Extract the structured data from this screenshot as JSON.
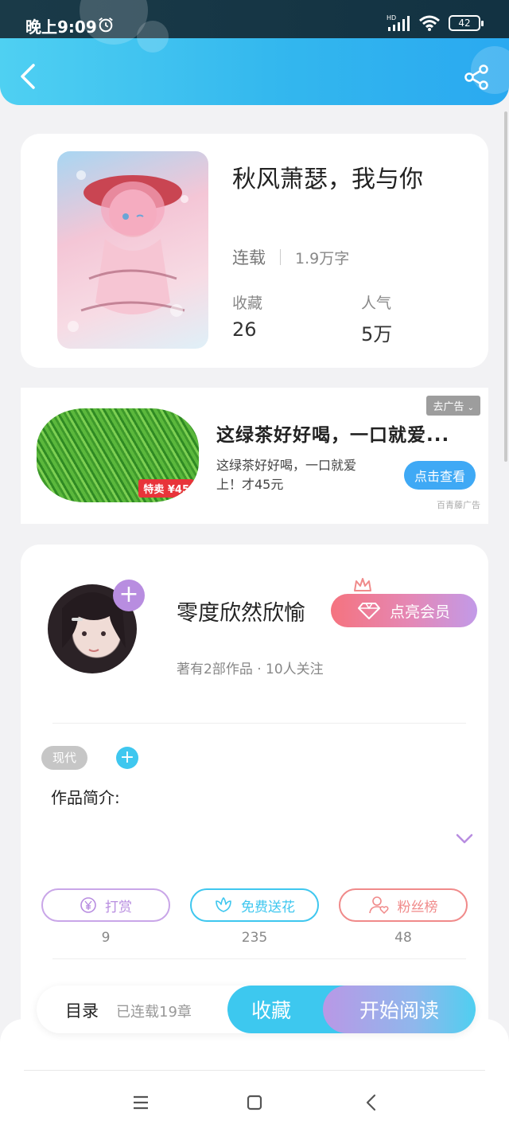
{
  "status_bar": {
    "time": "晚上9:09",
    "network": "HD",
    "battery": "42"
  },
  "header": {
    "back_icon": "chevron-left-icon",
    "share_icon": "share-icon"
  },
  "book": {
    "title": "秋风萧瑟，我与你",
    "status": "连载",
    "word_count": "1.9万字",
    "stats": [
      {
        "label": "收藏",
        "value": "26"
      },
      {
        "label": "人气",
        "value": "5万"
      }
    ]
  },
  "ad": {
    "remove_label": "去广告",
    "title": "这绿茶好好喝，一口就爱...",
    "description": "这绿茶好好喝，一口就爱上！才45元",
    "button_label": "点击查看",
    "source": "百青藤广告",
    "image_badge": "特卖 ¥45"
  },
  "author": {
    "name": "零度欣然欣愉",
    "vip_label": "点亮会员",
    "meta": "著有2部作品 · 10人关注",
    "tag": "现代",
    "intro_label": "作品简介:"
  },
  "actions": [
    {
      "label": "打赏",
      "count": "9",
      "color": "#b88de0",
      "icon": "yen-coin-icon"
    },
    {
      "label": "免费送花",
      "count": "235",
      "color": "#3fc7ef",
      "icon": "flower-icon"
    },
    {
      "label": "粉丝榜",
      "count": "48",
      "color": "#f08a8a",
      "icon": "user-heart-icon"
    }
  ],
  "bottom_bar": {
    "toc_label": "目录",
    "chapter_info": "已连载19章",
    "favorite_label": "收藏",
    "read_label": "开始阅读"
  },
  "colors": {
    "accent": "#3dc8ef",
    "purple": "#b88de0",
    "vip_start": "#f5737f"
  }
}
